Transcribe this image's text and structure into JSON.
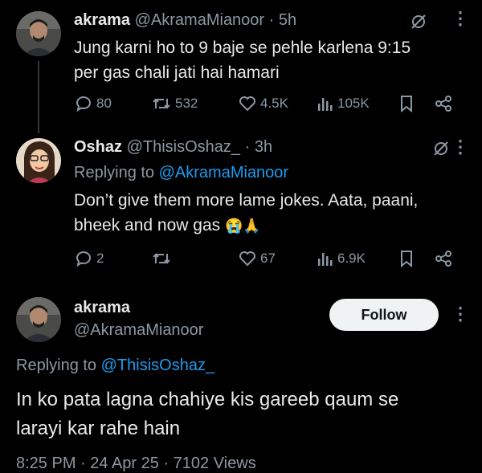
{
  "tweets": [
    {
      "display_name": "akrama",
      "handle": "@AkramaMianoor",
      "time": "· 5h",
      "text_line1": "Jung karni ho to 9 baje se pehle karlena 9:15",
      "text_line2": "per gas chali jati hai hamari",
      "stats": {
        "replies": "80",
        "reposts": "532",
        "likes": "4.5K",
        "views": "105K"
      }
    },
    {
      "display_name": "Oshaz",
      "handle": "@ThisisOshaz_",
      "time": "· 3h",
      "replying_prefix": "Replying to",
      "replying_to": "@AkramaMianoor",
      "text_line1": "Don’t give them more lame jokes. Aata, paani,",
      "text_line2": "bheek and now gas",
      "emojis": "😭🙏",
      "stats": {
        "replies": "2",
        "reposts": "",
        "likes": "67",
        "views": "6.9K"
      }
    },
    {
      "display_name": "akrama",
      "handle": "@AkramaMianoor",
      "follow_label": "Follow",
      "replying_prefix": "Replying to",
      "replying_to": "@ThisisOshaz_",
      "text_line1": "In ko pata lagna chahiye kis gareeb qaum se",
      "text_line2": "larayi kar rahe hain",
      "meta_line": "8:25 PM · 24 Apr 25 · 7102 Views"
    }
  ],
  "icons": [
    "grok-icon",
    "more-icon",
    "reply-icon",
    "repost-icon",
    "like-icon",
    "views-icon",
    "bookmark-icon",
    "share-icon"
  ],
  "colors": {
    "background": "#000000",
    "text": "#e7e9ea",
    "muted": "#8b98a5",
    "link": "#1d9bf0"
  }
}
